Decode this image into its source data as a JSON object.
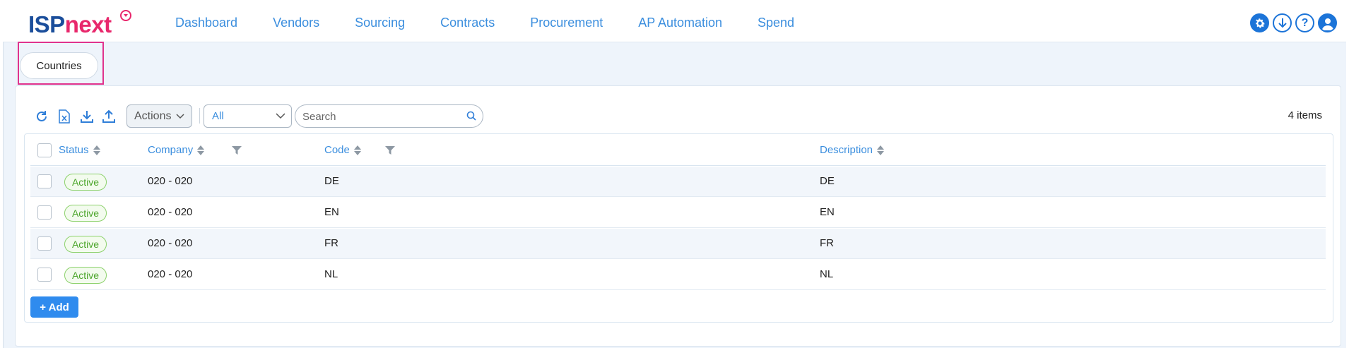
{
  "app": {
    "logo_part1": "ISP",
    "logo_part2": "next"
  },
  "nav": {
    "items": [
      "Dashboard",
      "Vendors",
      "Sourcing",
      "Contracts",
      "Procurement",
      "AP Automation",
      "Spend"
    ],
    "icons": [
      "gear-icon",
      "download-icon",
      "help-icon",
      "user-icon"
    ],
    "help_glyph": "?"
  },
  "breadcrumb": {
    "tab_label": "Countries"
  },
  "toolbar": {
    "icons": [
      "refresh-icon",
      "excel-export-icon",
      "download-icon",
      "upload-icon"
    ],
    "actions_label": "Actions",
    "filter_value": "All",
    "search_placeholder": "Search",
    "item_count": "4 items"
  },
  "table": {
    "columns": {
      "status": "Status",
      "company": "Company",
      "code": "Code",
      "description": "Description"
    },
    "rows": [
      {
        "status": "Active",
        "company": "020 - 020",
        "code": "DE",
        "description": "DE"
      },
      {
        "status": "Active",
        "company": "020 - 020",
        "code": "EN",
        "description": "EN"
      },
      {
        "status": "Active",
        "company": "020 - 020",
        "code": "FR",
        "description": "FR"
      },
      {
        "status": "Active",
        "company": "020 - 020",
        "code": "NL",
        "description": "NL"
      }
    ],
    "add_label": "+ Add"
  },
  "colors": {
    "accent": "#3b8ede",
    "brand_primary": "#1b4e9b",
    "brand_secondary": "#e8286c",
    "status_active": "#4ba52a",
    "highlight": "#e0338d"
  }
}
